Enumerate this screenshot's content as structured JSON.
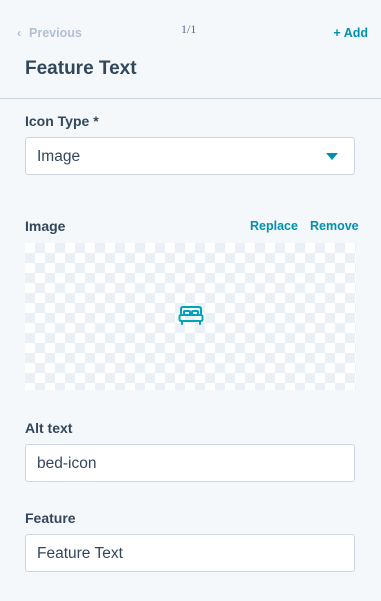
{
  "header": {
    "previous_label": "Previous",
    "page_count": "1/1",
    "add_label": "+ Add",
    "title": "Feature Text"
  },
  "icon_type": {
    "label": "Icon Type *",
    "value": "Image"
  },
  "image": {
    "label": "Image",
    "replace_label": "Replace",
    "remove_label": "Remove",
    "icon": "bed-icon",
    "icon_color": "#00a4bd"
  },
  "alt_text": {
    "label": "Alt text",
    "value": "bed-icon"
  },
  "feature": {
    "label": "Feature",
    "value": "Feature Text"
  },
  "colors": {
    "accent": "#0091ae",
    "text": "#33475b",
    "border": "#cbd6e2",
    "background": "#f5f8fa"
  }
}
